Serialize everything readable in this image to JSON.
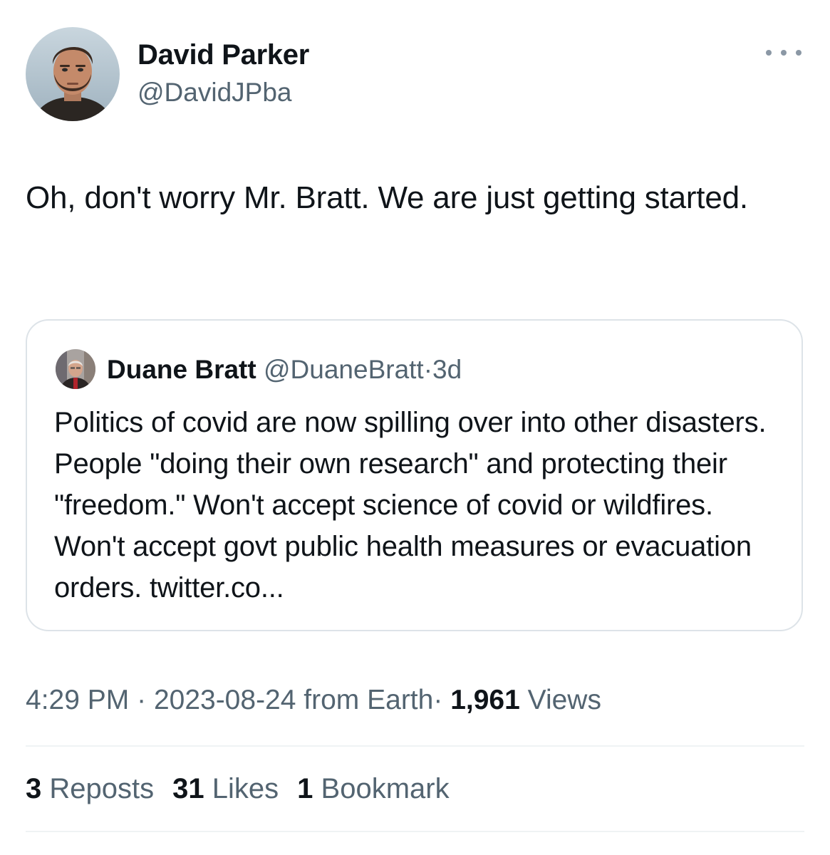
{
  "tweet": {
    "author": {
      "name": "David Parker",
      "handle": "@DavidJPba"
    },
    "text": "Oh, don't worry Mr. Bratt. We are just getting started.",
    "more_icon": "more-horizontal-icon",
    "quote": {
      "author_name": "Duane Bratt",
      "author_handle": "@DuaneBratt",
      "separator": "·",
      "time": "3d",
      "text": "Politics of covid are now spilling over into other disasters. People \"doing their own research\" and protecting their \"freedom.\" Won't accept science of covid or wildfires. Won't accept govt public health measures or evacuation orders. twitter.co..."
    },
    "meta": {
      "time": "4:29 PM",
      "separator": "·",
      "date": "2023-08-24",
      "source": "from Earth",
      "separator2": "·",
      "views_count": "1,961",
      "views_label": "Views"
    },
    "stats": {
      "reposts_count": "3",
      "reposts_label": "Reposts",
      "likes_count": "31",
      "likes_label": "Likes",
      "bookmarks_count": "1",
      "bookmarks_label": "Bookmark"
    }
  },
  "colors": {
    "text_primary": "#0f1419",
    "text_secondary": "#536471",
    "border": "#dde3e8",
    "divider": "#eff3f4"
  }
}
